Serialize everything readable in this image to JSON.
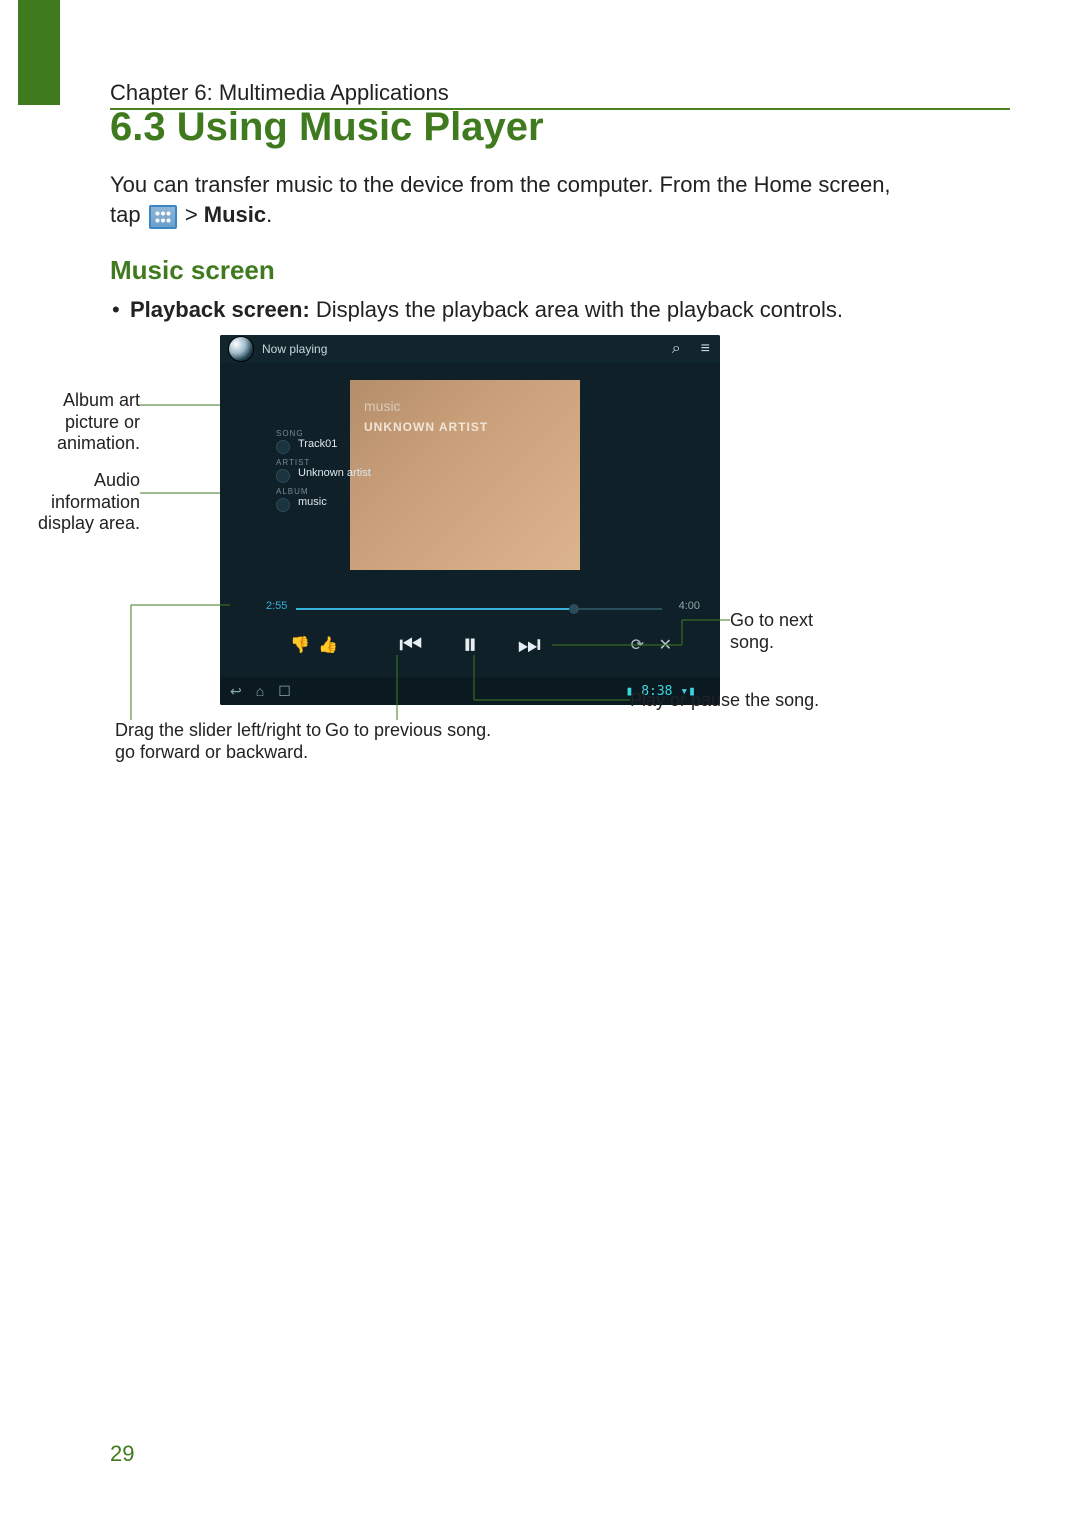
{
  "chapter_header": "Chapter 6: Multimedia Applications",
  "section_title": "6.3 Using Music Player",
  "intro": {
    "line1": "You can transfer music to the device from the computer. From the Home screen,",
    "tap_word": "tap ",
    "gt": " > ",
    "music_bold": "Music",
    "period": "."
  },
  "subhead": "Music screen",
  "bullet": {
    "bold": "Playback screen: ",
    "rest": "Displays the playback area with the playback controls."
  },
  "device": {
    "now_playing": "Now playing",
    "album_label": "music",
    "unknown_artist": "UNKNOWN ARTIST",
    "meta": {
      "song_k": "SONG",
      "song_v": "Track01",
      "artist_k": "ARTIST",
      "artist_v": "Unknown artist",
      "album_k": "ALBUM",
      "album_v": "music"
    },
    "time_elapsed": "2:55",
    "time_total": "4:00",
    "status_time": "8:38"
  },
  "callouts": {
    "album_art": "Album art picture or animation.",
    "audio_info": "Audio information display area.",
    "slider": "Drag the slider left/right to go forward or backward.",
    "prev": "Go to previous song.",
    "next": "Go to next song.",
    "play": "Play or pause the song."
  },
  "page_number": "29"
}
